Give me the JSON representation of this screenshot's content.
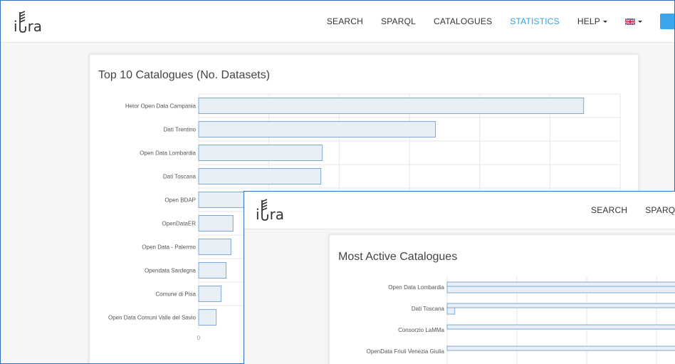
{
  "brand": {
    "part1": "i",
    "part2": "ra"
  },
  "nav": {
    "search": "SEARCH",
    "sparql": "SPARQL",
    "catalogues": "CATALOGUES",
    "statistics": "STATISTICS",
    "help": "HELP"
  },
  "colors": {
    "accent": "#33a0dd",
    "window_border": "#2f72c4",
    "bar_fill": "#e8eff6",
    "bar_stroke": "#7fa9d3"
  },
  "icons": {
    "flag": "uk-flag-icon",
    "caret": "caret-down-icon"
  },
  "top10": {
    "title": "Top 10 Catalogues (No. Datasets)",
    "chart_data": {
      "type": "bar",
      "orientation": "horizontal",
      "title": "Top 10 Catalogues (No. Datasets)",
      "categories": [
        "Hetor Open Data Campania",
        "Dati Trentino",
        "Open Data Lombardia",
        "Dati Toscana",
        "Open BDAP",
        "OpenDataER",
        "Open Data - Palermo",
        "Opendata Sardegna",
        "Comune di Pisa",
        "Open Data Comuni Valle del Savio"
      ],
      "values": [
        5480,
        3370,
        1760,
        1740,
        900,
        490,
        460,
        390,
        320,
        250
      ],
      "xlim": [
        0,
        6000
      ],
      "x_tick_labels": [
        "0"
      ],
      "grid": true
    }
  },
  "active": {
    "title": "Most Active Catalogues",
    "chart_data": {
      "type": "bar",
      "orientation": "horizontal",
      "title": "Most Active Catalogues",
      "categories": [
        "Open Data Lombardia",
        "Dati Toscana",
        "Consorzio LaMMa",
        "OpenData Friuli Venezia Giulia"
      ],
      "series": [
        {
          "values": [
            340,
            340,
            340,
            340
          ]
        },
        {
          "values": [
            340,
            8,
            0,
            0
          ]
        }
      ],
      "xlim": [
        0,
        340
      ],
      "grid": true
    }
  }
}
